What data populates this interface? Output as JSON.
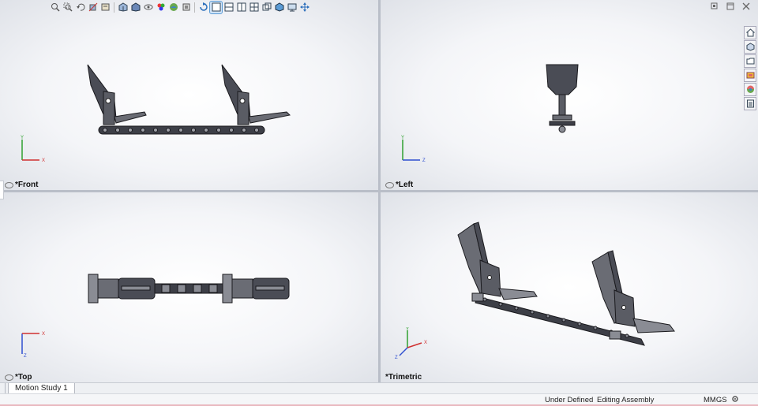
{
  "viewports": {
    "front": {
      "label": "*Front",
      "axis_a": "Y",
      "axis_b": "X"
    },
    "left": {
      "label": "*Left",
      "axis_a": "Y",
      "axis_b": "Z"
    },
    "top": {
      "label": "*Top",
      "axis_a": "Z",
      "axis_b": "X"
    },
    "trimetric": {
      "label": "*Trimetric",
      "axis_a": "Y",
      "axis_b": "X",
      "axis_c": "Z"
    }
  },
  "toolbar": {
    "icons": [
      "zoom-to-fit-icon",
      "zoom-to-area-icon",
      "previous-view-icon",
      "section-view-icon",
      "dynamic-annotation-icon",
      "view-orientation-icon",
      "display-style-icon",
      "hide-show-icon",
      "edit-appearance-icon",
      "apply-scene-icon",
      "view-settings-icon",
      "single-view-icon",
      "two-view-horizontal-icon",
      "two-view-vertical-icon",
      "four-view-icon",
      "link-views-icon",
      "isometric-icon",
      "monitor-icon",
      "move-icon"
    ]
  },
  "task_pane": [
    "home-icon",
    "design-library-icon",
    "file-explorer-icon",
    "view-palette-icon",
    "appearances-icon",
    "custom-properties-icon"
  ],
  "tabs": {
    "motion_study": "Motion Study 1"
  },
  "status": {
    "definition": "Under Defined",
    "mode": "Editing Assembly",
    "units": "MMGS"
  },
  "colors": {
    "part": "#4a4c55",
    "part_light": "#8a8c94",
    "edge": "#1a1a1e",
    "x_axis": "#d03030",
    "y_axis": "#2fa02f",
    "z_axis": "#2f4fd0"
  }
}
